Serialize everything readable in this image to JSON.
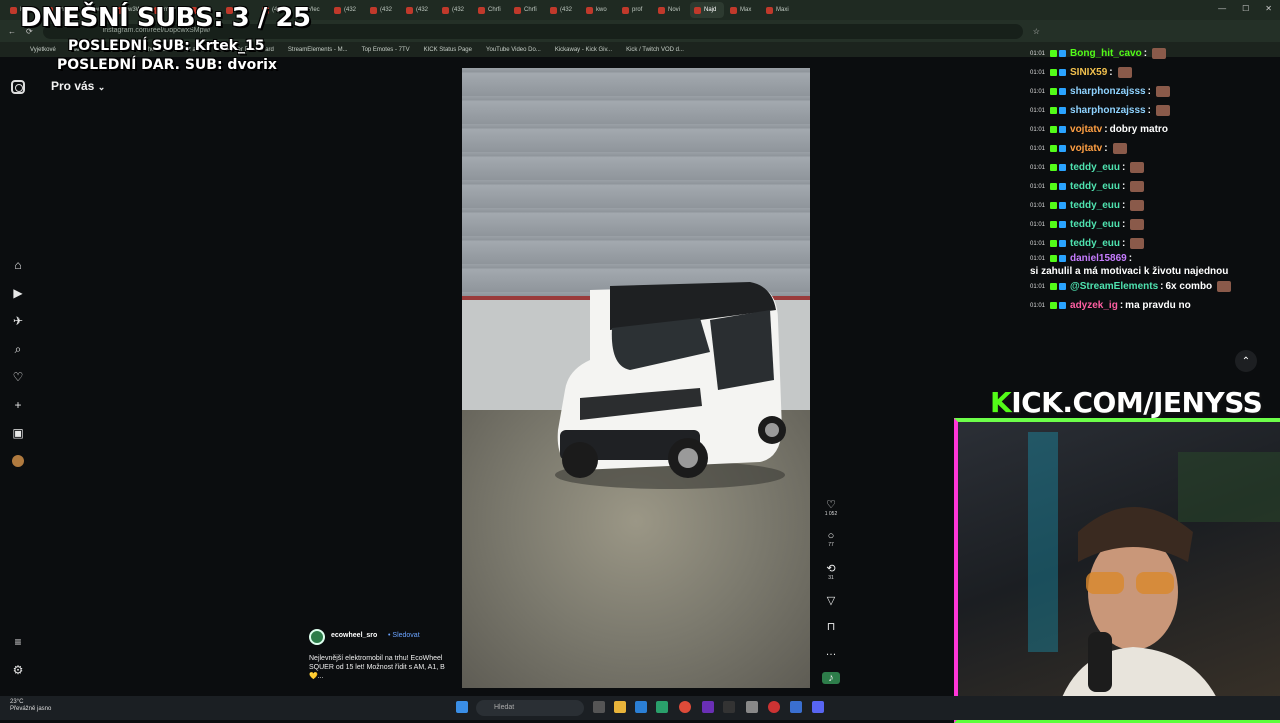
{
  "browser": {
    "tabs": [
      "Kick",
      "Chrfi",
      "Kwu",
      "w3W",
      "mZz",
      "profi",
      "(99+",
      "(432",
      "Vlec",
      "(432",
      "(432",
      "(432",
      "(432",
      "Chrfi",
      "Chrfi",
      "(432",
      "kwo",
      "prof",
      "Novi",
      "Najd",
      "Max",
      "Maxi"
    ],
    "address": "instagram.com/reel/DbpcwxSMpw/",
    "bookmarks": [
      "Vyjetkové",
      "File Converter - Free...",
      "The best ChatBot an...",
      "Streamer Dashboard",
      "StreamElements - M...",
      "Top Emotes - 7TV",
      "KICK Status Page",
      "YouTube Video Do...",
      "Kickaway - Kick Giv...",
      "Kick / Twitch VOD d..."
    ]
  },
  "overlay": {
    "subs_title": "DNEŠNÍ SUBS: 3 / 25",
    "last_sub": "POSLEDNÍ SUB: Krtek_15",
    "last_dar": "POSLEDNÍ DAR. SUB: dvorix"
  },
  "instagram": {
    "feed_label": "Pro vás",
    "likes": "1 052",
    "comments": "77",
    "reposts": "31",
    "author": "ecowheel_sro",
    "follow": "• Sledovat",
    "caption": "Nejlevnější elektromobil na trhu! EcoWheel SQUER od 15 let! Možnost řídit s AM, A1, B 💛..."
  },
  "chat": [
    {
      "time": "01:01",
      "user": "Bong_hit_cavo",
      "color": "#53fc18",
      "text": ""
    },
    {
      "time": "01:01",
      "user": "SINIX59",
      "color": "#f2c14e",
      "text": ""
    },
    {
      "time": "01:01",
      "user": "sharphonzajsss",
      "color": "#8fd3ff",
      "text": ""
    },
    {
      "time": "01:01",
      "user": "sharphonzajsss",
      "color": "#8fd3ff",
      "text": ""
    },
    {
      "time": "01:01",
      "user": "vojtatv",
      "color": "#ff9f43",
      "text": "dobry matro"
    },
    {
      "time": "01:01",
      "user": "vojtatv",
      "color": "#ff9f43",
      "text": ""
    },
    {
      "time": "01:01",
      "user": "teddy_euu",
      "color": "#4fe3b0",
      "text": ""
    },
    {
      "time": "01:01",
      "user": "teddy_euu",
      "color": "#4fe3b0",
      "text": ""
    },
    {
      "time": "01:01",
      "user": "teddy_euu",
      "color": "#4fe3b0",
      "text": ""
    },
    {
      "time": "01:01",
      "user": "teddy_euu",
      "color": "#4fe3b0",
      "text": ""
    },
    {
      "time": "01:01",
      "user": "teddy_euu",
      "color": "#4fe3b0",
      "text": ""
    },
    {
      "time": "01:01",
      "user": "daniel15869",
      "color": "#c77dff",
      "text": "si zahulil a má motivaci k životu najednou"
    },
    {
      "time": "01:01",
      "user": "@StreamElements",
      "color": "#4fe3b0",
      "text": "6x combo"
    },
    {
      "time": "01:01",
      "user": "adyzek_ig",
      "color": "#ff5fa2",
      "text": "ma pravdu no"
    }
  ],
  "kick": {
    "k": "K",
    "rest": "ICK.COM/JENYSS"
  },
  "taskbar": {
    "temp": "23°C",
    "weather": "Převážně jasno",
    "search": "Hledat"
  }
}
